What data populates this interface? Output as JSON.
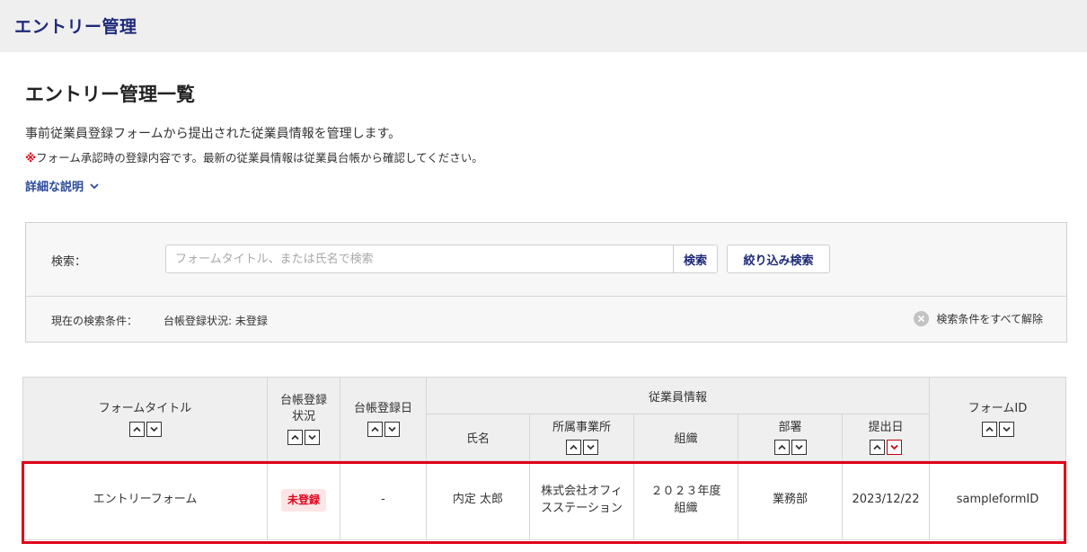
{
  "header": {
    "title": "エントリー管理"
  },
  "page": {
    "title": "エントリー管理一覧",
    "description": "事前従業員登録フォームから提出された従業員情報を管理します。",
    "note_mark": "※",
    "note": "フォーム承認時の登録内容です。最新の従業員情報は従業員台帳から確認してください。",
    "detail_link": "詳細な説明"
  },
  "search": {
    "label": "検索：",
    "placeholder": "フォームタイトル、または氏名で検索",
    "button": "検索",
    "filter_button": "絞り込み検索",
    "condition_label": "現在の検索条件：",
    "condition_value": "台帳登録状況: 未登録",
    "clear_all": "検索条件をすべて解除"
  },
  "table": {
    "headers": {
      "form_title": "フォームタイトル",
      "status_1": "台帳登録",
      "status_2": "状況",
      "reg_date": "台帳登録日",
      "employee_info": "従業員情報",
      "name": "氏名",
      "office": "所属事業所",
      "org": "組織",
      "dept": "部署",
      "submit_date": "提出日",
      "form_id": "フォームID"
    },
    "rows": [
      {
        "form_title": "エントリーフォーム",
        "status": "未登録",
        "reg_date": "-",
        "name": "内定 太郎",
        "office": "株式会社オフィスステーション",
        "org": "２０２３年度組織",
        "dept": "業務部",
        "submit_date": "2023/12/22",
        "form_id": "sampleformID"
      }
    ]
  },
  "colors": {
    "brand": "#1e2a78",
    "alert": "#e0001b",
    "header_bg": "#efefef"
  },
  "icons": {
    "detail": "chevron-down-icon",
    "clear": "close-circle-icon",
    "sort_asc": "chevron-up-icon",
    "sort_desc": "chevron-down-icon"
  }
}
